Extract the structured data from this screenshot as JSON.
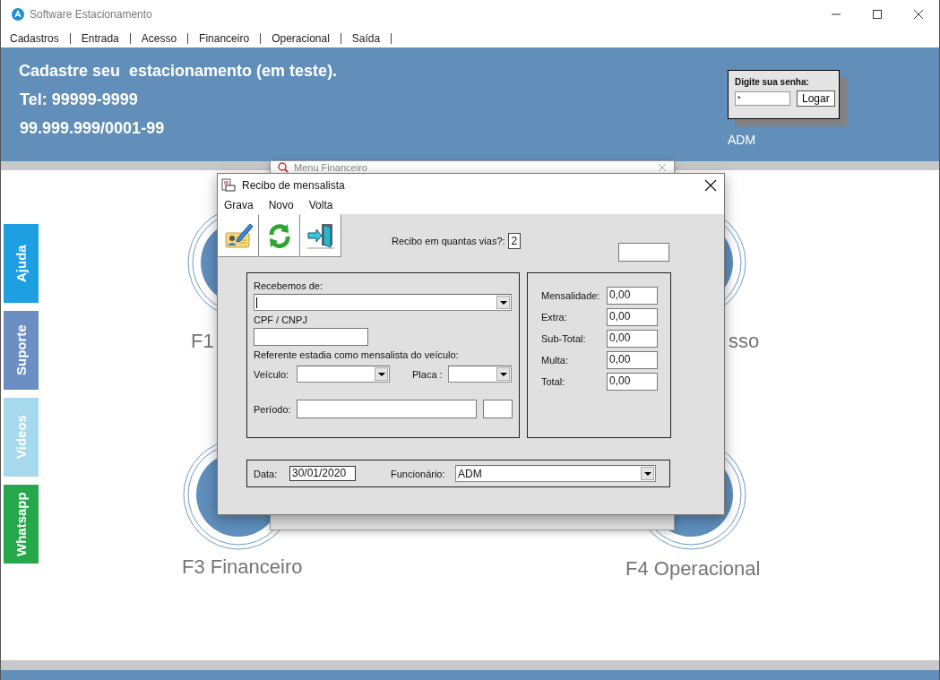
{
  "window": {
    "title": "Software Estacionamento"
  },
  "menu": [
    "Cadastros",
    "Entrada",
    "Acesso",
    "Financeiro",
    "Operacional",
    "Saída"
  ],
  "header": {
    "lines": [
      "Cadastre seu  estacionamento (em teste).",
      "Tel: 99999-9999",
      "99.999.999/0001-99"
    ],
    "login": {
      "label": "Digite sua senha:",
      "value": "*",
      "button": "Logar"
    },
    "user": "ADM"
  },
  "side_tabs": [
    {
      "label": "Ajuda",
      "color": "#1e9fe2"
    },
    {
      "label": "Suporte",
      "color": "#6b8fc2"
    },
    {
      "label": "Videos",
      "color": "#a6d9ec"
    },
    {
      "label": "Whatsapp",
      "color": "#26a84a"
    }
  ],
  "shortcuts": [
    {
      "label": "F1"
    },
    {
      "label": "sso"
    },
    {
      "label": "F3 Financeiro"
    },
    {
      "label": "F4 Operacional"
    }
  ],
  "back_window": {
    "title": "Menu Financeiro"
  },
  "dialog": {
    "title": "Recibo de mensalista",
    "menu": [
      "Grava",
      "Novo",
      "Volta"
    ],
    "copies": {
      "label": "Recibo em quantas vias?:",
      "value": "2"
    },
    "received_from": {
      "label": "Recebemos de:"
    },
    "document": {
      "label": "CPF / CNPJ"
    },
    "reference": "Referente estadia como mensalista do veículo:",
    "vehicle": {
      "label": "Veículo:"
    },
    "plate": {
      "label": "Placa :"
    },
    "period": {
      "label": "Período:"
    },
    "amounts": [
      {
        "label": "Mensalidade:",
        "value": "0,00"
      },
      {
        "label": "Extra:",
        "value": "0,00"
      },
      {
        "label": "Sub-Total:",
        "value": "0,00"
      },
      {
        "label": "Multa:",
        "value": "0,00"
      },
      {
        "label": "Total:",
        "value": "0,00"
      }
    ],
    "date": {
      "label": "Data:",
      "value": "30/01/2020"
    },
    "employee": {
      "label": "Funcionário:",
      "value": "ADM"
    }
  }
}
